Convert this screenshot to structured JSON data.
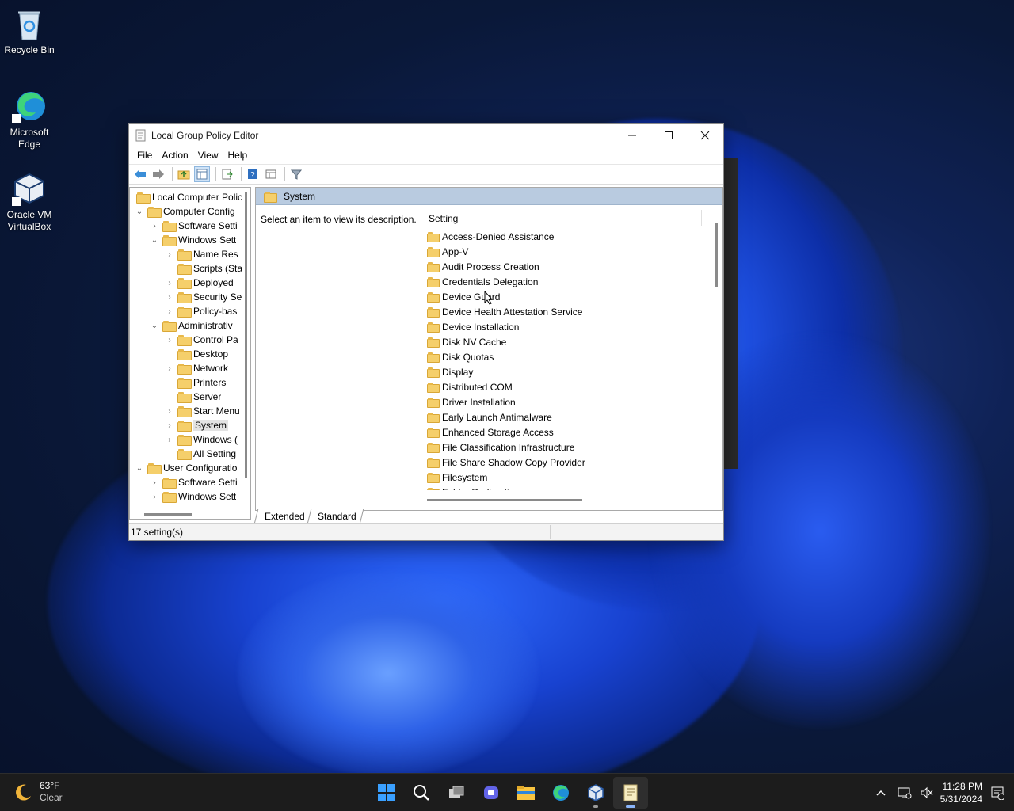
{
  "desktop": {
    "icons": [
      {
        "label_line1": "Recycle Bin",
        "label_line2": ""
      },
      {
        "label_line1": "Microsoft",
        "label_line2": "Edge"
      },
      {
        "label_line1": "Oracle VM",
        "label_line2": "VirtualBox"
      }
    ]
  },
  "window": {
    "title": "Local Group Policy Editor",
    "menu": [
      "File",
      "Action",
      "View",
      "Help"
    ],
    "tree": [
      {
        "label": "Local Computer Polic",
        "depth": 0,
        "arrow": ""
      },
      {
        "label": "Computer Config",
        "depth": 0,
        "arrow": "v"
      },
      {
        "label": "Software Setti",
        "depth": 1,
        "arrow": ">"
      },
      {
        "label": "Windows Sett",
        "depth": 1,
        "arrow": "v"
      },
      {
        "label": "Name Res",
        "depth": 2,
        "arrow": ">"
      },
      {
        "label": "Scripts (Sta",
        "depth": 2,
        "arrow": ""
      },
      {
        "label": "Deployed",
        "depth": 2,
        "arrow": ">"
      },
      {
        "label": "Security Se",
        "depth": 2,
        "arrow": ">"
      },
      {
        "label": "Policy-bas",
        "depth": 2,
        "arrow": ">"
      },
      {
        "label": "Administrativ",
        "depth": 1,
        "arrow": "v"
      },
      {
        "label": "Control Pa",
        "depth": 2,
        "arrow": ">"
      },
      {
        "label": "Desktop",
        "depth": 2,
        "arrow": ""
      },
      {
        "label": "Network",
        "depth": 2,
        "arrow": ">"
      },
      {
        "label": "Printers",
        "depth": 2,
        "arrow": ""
      },
      {
        "label": "Server",
        "depth": 2,
        "arrow": ""
      },
      {
        "label": "Start Menu",
        "depth": 2,
        "arrow": ">"
      },
      {
        "label": "System",
        "depth": 2,
        "arrow": ">"
      },
      {
        "label": "Windows (",
        "depth": 2,
        "arrow": ">"
      },
      {
        "label": "All Setting",
        "depth": 2,
        "arrow": ""
      },
      {
        "label": "User Configuratio",
        "depth": 0,
        "arrow": "v"
      },
      {
        "label": "Software Setti",
        "depth": 1,
        "arrow": ">"
      },
      {
        "label": "Windows Sett",
        "depth": 1,
        "arrow": ">"
      }
    ],
    "pane_header": "System",
    "description": "Select an item to view its description.",
    "column_header": "Setting",
    "settings": [
      "Access-Denied Assistance",
      "App-V",
      "Audit Process Creation",
      "Credentials Delegation",
      "Device Guard",
      "Device Health Attestation Service",
      "Device Installation",
      "Disk NV Cache",
      "Disk Quotas",
      "Display",
      "Distributed COM",
      "Driver Installation",
      "Early Launch Antimalware",
      "Enhanced Storage Access",
      "File Classification Infrastructure",
      "File Share Shadow Copy Provider",
      "Filesystem",
      "Folder Redirection"
    ],
    "tabs": [
      "Extended",
      "Standard"
    ],
    "status": "17 setting(s)"
  },
  "taskbar": {
    "temperature": "63°F",
    "condition": "Clear",
    "time": "11:28 PM",
    "date": "5/31/2024"
  }
}
